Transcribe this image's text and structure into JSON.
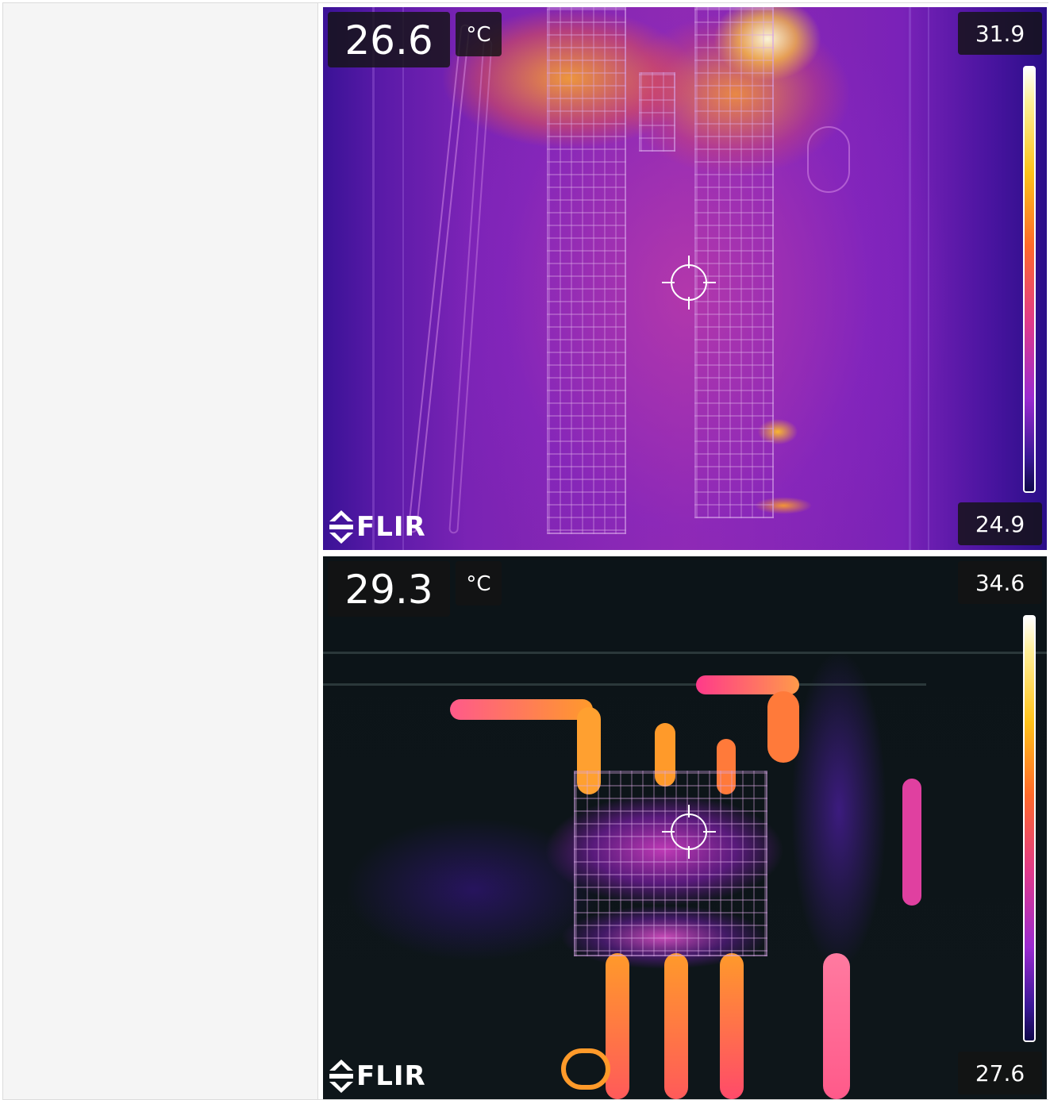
{
  "rows": [
    {
      "image": "electrical-panel-thermal",
      "spot_temp": "26.6",
      "unit": "°C",
      "scale_max": "31.9",
      "scale_min": "24.9",
      "brand": "FLIR",
      "palette": "iron"
    },
    {
      "image": "terminal-block-thermal",
      "spot_temp": "29.3",
      "unit": "°C",
      "scale_max": "34.6",
      "scale_min": "27.6",
      "brand": "FLIR",
      "palette": "iron"
    }
  ],
  "icons": [
    "crosshair-icon",
    "flir-logo-icon",
    "color-scale-bar"
  ]
}
